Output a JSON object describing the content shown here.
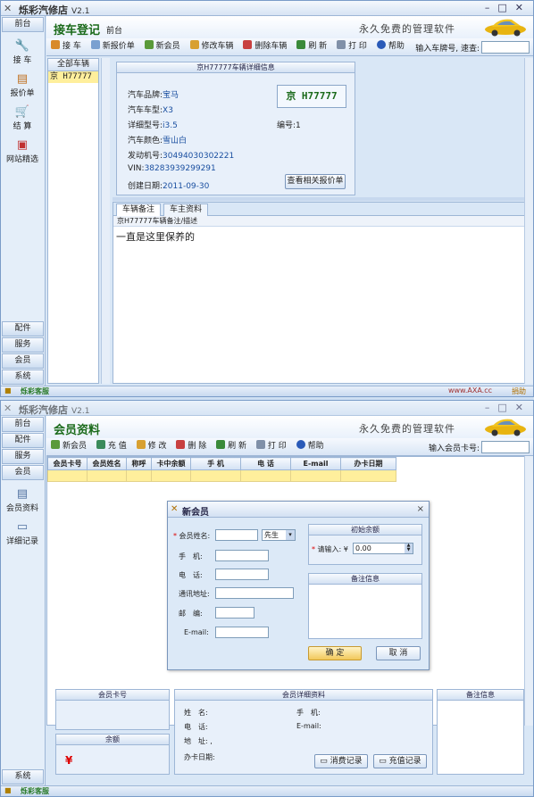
{
  "colors": {
    "accent": "#1a6a1a",
    "row_highlight": "#ffef9c",
    "link": "#1a4fa0",
    "url": "#a03030"
  },
  "w1": {
    "app_title": "烁彩汽修店",
    "version": "V2.1",
    "sidebar": {
      "tab": "前台",
      "items": [
        {
          "icon": "wrench-icon",
          "label": "接 车"
        },
        {
          "icon": "price-sheet-icon",
          "label": "报价单"
        },
        {
          "icon": "cart-icon",
          "label": "结 算"
        },
        {
          "icon": "gift-icon",
          "label": "网站精选"
        }
      ],
      "bottom": [
        "配件",
        "服务",
        "会员",
        "系统"
      ]
    },
    "header": {
      "title": "接车登记",
      "subtitle": "前台",
      "slogan": "永久免费的管理软件"
    },
    "toolbar": {
      "buttons": [
        "接 车",
        "新报价单",
        "新会员",
        "修改车辆",
        "删除车辆",
        "刷 新",
        "打 印",
        "帮助"
      ],
      "search_label": "输入车牌号, 速查:",
      "search_value": ""
    },
    "carlist": {
      "header": "全部车辆",
      "rows": [
        "京 H77777"
      ]
    },
    "detail": {
      "panel_title": "京H77777车辆详细信息",
      "plate": "京 H77777",
      "fields": [
        {
          "label": "汽车品牌:",
          "value": "宝马"
        },
        {
          "label": "汽车车型:",
          "value": "X3"
        },
        {
          "label": "详细型号:",
          "value": "i3.5"
        },
        {
          "label": "汽车颜色:",
          "value": "雪山白"
        },
        {
          "label": "发动机号:",
          "value": "30494030302221"
        },
        {
          "label": "VIN:",
          "value": "38283939299291"
        },
        {
          "label": "创建日期:",
          "value": "2011-09-30"
        }
      ],
      "number_label": "编号:",
      "number_value": "1",
      "quote_button": "查看相关报价单"
    },
    "notes": {
      "tabs": [
        "车辆备注",
        "车主资料"
      ],
      "subheader": "京H77777车辆备注/描述",
      "body": "一直是这里保养的"
    },
    "status": {
      "brand": "烁彩客服",
      "url": "www.AXA.cc",
      "donate": "捐助"
    }
  },
  "w2": {
    "app_title": "烁彩汽修店",
    "version": "V2.1",
    "sidebar": {
      "tabs": [
        "前台",
        "配件",
        "服务",
        "会员"
      ],
      "items": [
        {
          "icon": "member-card-icon",
          "label": "会员资料"
        },
        {
          "icon": "folder-icon",
          "label": "详细记录"
        }
      ],
      "bottom": "系统"
    },
    "header": {
      "title": "会员资料",
      "slogan": "永久免费的管理软件"
    },
    "toolbar": {
      "buttons": [
        "新会员",
        "充 值",
        "修 改",
        "删 除",
        "刷 新",
        "打 印",
        "帮助"
      ],
      "search_label": "输入会员卡号:",
      "search_value": ""
    },
    "grid": {
      "columns": [
        "会员卡号",
        "会员姓名",
        "称呼",
        "卡中余额",
        "手 机",
        "电 话",
        "E-mail",
        "办卡日期"
      ]
    },
    "dialog": {
      "title": "新会员",
      "name_label": "会员姓名:",
      "name_value": "",
      "salutation": "先生",
      "mobile_label": "手　机:",
      "phone_label": "电　话:",
      "address_label": "通讯地址:",
      "zip_label": "邮　编:",
      "email_label": "E-mail:",
      "initial_balance_title": "初始余额",
      "amount_label": "请输入: ¥",
      "amount_value": "0.00",
      "remarks_title": "备注信息",
      "ok": "确 定",
      "cancel": "取 消"
    },
    "bottom": {
      "card_title": "会员卡号",
      "balance_title": "余额",
      "currency": "¥",
      "details_title": "会员详细资料",
      "name": "姓　名:",
      "mobile": "手　机:",
      "phone": "电　话:",
      "email": "E-mail:",
      "address": "地　址:",
      "address_value": ",",
      "card_date": "办卡日期:",
      "consume_button": "消费记录",
      "topup_button": "充值记录",
      "remarks_title": "备注信息"
    },
    "status": {
      "brand": "烁彩客服"
    }
  }
}
